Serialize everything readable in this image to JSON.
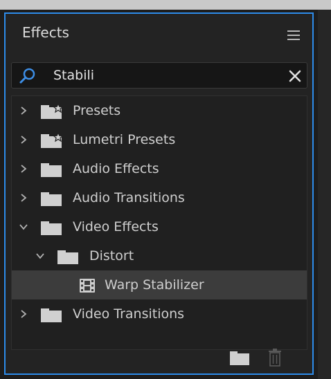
{
  "panel": {
    "title": "Effects"
  },
  "search": {
    "value": "Stabili"
  },
  "tree": [
    {
      "label": "Presets",
      "icon": "preset-folder-icon",
      "state": "collapsed"
    },
    {
      "label": "Lumetri Presets",
      "icon": "preset-folder-icon",
      "state": "collapsed"
    },
    {
      "label": "Audio Effects",
      "icon": "folder-icon",
      "state": "collapsed"
    },
    {
      "label": "Audio Transitions",
      "icon": "folder-icon",
      "state": "collapsed"
    },
    {
      "label": "Video Effects",
      "icon": "folder-icon",
      "state": "expanded"
    },
    {
      "label": "Distort",
      "icon": "folder-icon",
      "state": "expanded"
    },
    {
      "label": "Warp Stabilizer",
      "icon": "effect-icon",
      "state": "selected"
    },
    {
      "label": "Video Transitions",
      "icon": "folder-icon",
      "state": "collapsed"
    }
  ],
  "colors": {
    "accent": "#2d8ceb",
    "selection": "#3c3c3c",
    "panel_bg": "#232323"
  }
}
